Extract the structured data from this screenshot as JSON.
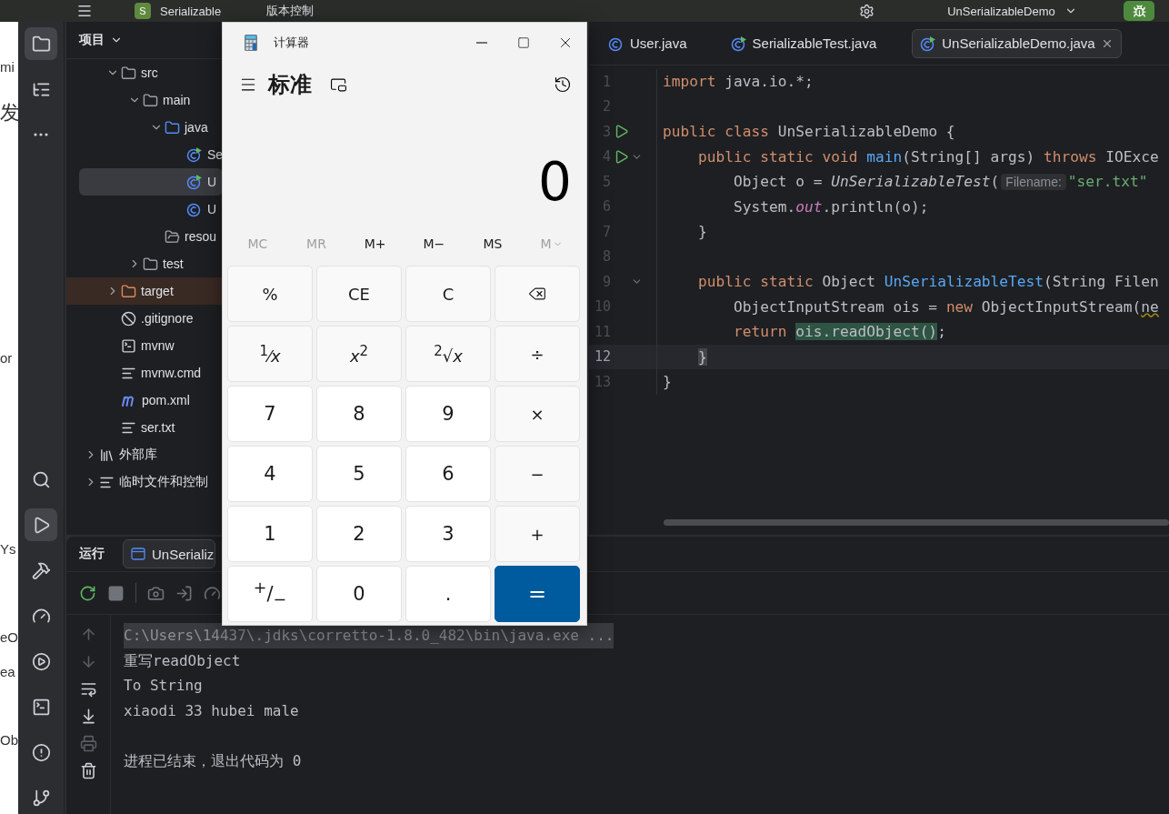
{
  "top_bar": {
    "project_badge": "S",
    "project": "Serializable",
    "vcs": "版本控制",
    "run_config": "UnSerializableDemo"
  },
  "browser_fragments": [
    {
      "text": "mi",
      "kind": "text"
    },
    {
      "text": "发",
      "kind": "heading"
    },
    {
      "text": "or",
      "kind": "text"
    },
    {
      "text": "Ys",
      "kind": "text"
    },
    {
      "text": "eO",
      "kind": "text"
    },
    {
      "text": "ea",
      "kind": "text"
    },
    {
      "text": "Ob",
      "kind": "text"
    }
  ],
  "rail": {
    "top": [
      {
        "kind": "folder",
        "selected": true
      },
      {
        "kind": "structure",
        "selected": false
      },
      {
        "kind": "more",
        "selected": false
      }
    ],
    "bottom": [
      {
        "kind": "search",
        "selected": false
      },
      {
        "kind": "run",
        "selected": true
      },
      {
        "kind": "build",
        "selected": false
      },
      {
        "kind": "profiler",
        "selected": false
      },
      {
        "kind": "services",
        "selected": false
      },
      {
        "kind": "terminal",
        "selected": false
      },
      {
        "kind": "problems",
        "selected": false
      },
      {
        "kind": "git",
        "selected": false
      }
    ]
  },
  "project_panel": {
    "title": "项目",
    "tree": [
      {
        "kind": "scrolled",
        "children": [
          {
            "label": "src",
            "kind": "folder",
            "expanded": true,
            "selected": false,
            "children": [
              {
                "label": "main",
                "kind": "folder",
                "expanded": true,
                "selected": false,
                "children": [
                  {
                    "label": "java",
                    "kind": "source-folder",
                    "expanded": true,
                    "selected": false,
                    "children": [
                      {
                        "label": "Se",
                        "kind": "class-run",
                        "selected": false
                      },
                      {
                        "label": "U",
                        "kind": "class-run",
                        "selected": true
                      },
                      {
                        "label": "U",
                        "kind": "class",
                        "selected": false
                      }
                    ]
                  },
                  {
                    "label": "resou",
                    "kind": "resources-folder",
                    "selected": false
                  }
                ]
              },
              {
                "label": "test",
                "kind": "folder",
                "expanded": false,
                "selected": false
              }
            ]
          },
          {
            "label": "target",
            "kind": "excluded-folder",
            "expanded": false,
            "selected": false
          },
          {
            "label": ".gitignore",
            "kind": "ignore",
            "selected": false
          },
          {
            "label": "mvnw",
            "kind": "script",
            "selected": false
          },
          {
            "label": "mvnw.cmd",
            "kind": "text",
            "selected": false
          },
          {
            "label": "pom.xml",
            "kind": "maven",
            "selected": false
          },
          {
            "label": "ser.txt",
            "kind": "text",
            "selected": false
          }
        ]
      },
      {
        "label": "外部库",
        "kind": "library",
        "expanded": false,
        "selected": false
      },
      {
        "label": "临时文件和控制",
        "kind": "scratch",
        "expanded": false,
        "selected": false
      }
    ]
  },
  "editor": {
    "tabs": [
      {
        "label": "User.java",
        "kind": "class",
        "selected": false
      },
      {
        "label": "SerializableTest.java",
        "kind": "class-run",
        "selected": false
      },
      {
        "label": "UnSerializableDemo.java",
        "kind": "class-run",
        "selected": true
      }
    ],
    "lines": [
      {
        "number": "1",
        "run": false,
        "fold": false,
        "current": false,
        "tokens": [
          {
            "text": "import ",
            "kind": "keyword"
          },
          {
            "text": "java.io.*;",
            "kind": "plain"
          }
        ]
      },
      {
        "number": "2",
        "run": false,
        "fold": false,
        "current": false
      },
      {
        "number": "3",
        "run": true,
        "fold": false,
        "current": false,
        "tokens": [
          {
            "text": "public class ",
            "kind": "keyword"
          },
          {
            "text": "UnSerializableDemo {",
            "kind": "plain"
          }
        ]
      },
      {
        "number": "4",
        "run": true,
        "fold": true,
        "current": false,
        "tokens": [
          {
            "text": "    public static void ",
            "kind": "keyword"
          },
          {
            "text": "main",
            "kind": "declaration"
          },
          {
            "text": "(String[] args) ",
            "kind": "plain"
          },
          {
            "text": "throws ",
            "kind": "keyword"
          },
          {
            "text": "IOExce",
            "kind": "plain"
          }
        ]
      },
      {
        "number": "5",
        "run": false,
        "fold": false,
        "current": false,
        "tokens": [
          {
            "text": "        Object o = ",
            "kind": "plain"
          },
          {
            "text": "UnSerializableTest",
            "kind": "static"
          },
          {
            "text": "(",
            "kind": "plain"
          },
          {
            "text": "Filename:",
            "kind": "hint"
          },
          {
            "text": "\"ser.txt\"",
            "kind": "string"
          }
        ]
      },
      {
        "number": "6",
        "run": false,
        "fold": false,
        "current": false,
        "tokens": [
          {
            "text": "        System.",
            "kind": "plain"
          },
          {
            "text": "out",
            "kind": "field"
          },
          {
            "text": ".println(o);",
            "kind": "plain"
          }
        ]
      },
      {
        "number": "7",
        "run": false,
        "fold": false,
        "current": false,
        "tokens": [
          {
            "text": "    }",
            "kind": "plain"
          }
        ]
      },
      {
        "number": "8",
        "run": false,
        "fold": false,
        "current": false
      },
      {
        "number": "9",
        "run": false,
        "fold": true,
        "current": false,
        "tokens": [
          {
            "text": "    public static ",
            "kind": "keyword"
          },
          {
            "text": "Object ",
            "kind": "plain"
          },
          {
            "text": "UnSerializableTest",
            "kind": "declaration"
          },
          {
            "text": "(String Filen",
            "kind": "plain"
          }
        ]
      },
      {
        "number": "10",
        "run": false,
        "fold": false,
        "current": false,
        "tokens": [
          {
            "text": "        ObjectInputStream ois = ",
            "kind": "plain"
          },
          {
            "text": "new ",
            "kind": "keyword"
          },
          {
            "text": "ObjectInputStream(",
            "kind": "plain"
          },
          {
            "text": "ne",
            "kind": "warning"
          }
        ]
      },
      {
        "number": "11",
        "run": false,
        "fold": false,
        "current": false,
        "tokens": [
          {
            "text": "        return ",
            "kind": "keyword"
          },
          {
            "text": "ois.readObject()",
            "kind": "match"
          },
          {
            "text": ";",
            "kind": "plain"
          }
        ]
      },
      {
        "number": "12",
        "run": false,
        "fold": false,
        "current": true,
        "tokens": [
          {
            "text": "    }",
            "kind": "brace"
          }
        ]
      },
      {
        "number": "13",
        "run": false,
        "fold": false,
        "current": false,
        "tokens": [
          {
            "text": "}",
            "kind": "plain"
          }
        ]
      }
    ]
  },
  "run_panel": {
    "title": "运行",
    "tab": "UnSerializ",
    "console": [
      {
        "text": "C:\\Users\\14437\\.jdks\\corretto-1.8.0_482\\bin\\java.exe ...",
        "kind": "command"
      },
      {
        "text": "重写readObject",
        "kind": "output"
      },
      {
        "text": "To String",
        "kind": "output"
      },
      {
        "text": "xiaodi 33 hubei male",
        "kind": "output"
      },
      {
        "kind": "blank"
      },
      {
        "text": "进程已结束，退出代码为 0",
        "kind": "output"
      }
    ]
  },
  "calculator": {
    "title": "计算器",
    "mode": "标准",
    "display": "0",
    "memory": [
      {
        "label": "MC",
        "disabled": true
      },
      {
        "label": "MR",
        "disabled": true
      },
      {
        "label": "M+",
        "disabled": false
      },
      {
        "label": "M−",
        "disabled": false
      },
      {
        "label": "MS",
        "disabled": false
      },
      {
        "label": "M",
        "disabled": true,
        "kind": "dropdown"
      }
    ],
    "keys": [
      {
        "label": "%",
        "kind": "function"
      },
      {
        "label": "CE",
        "kind": "function"
      },
      {
        "label": "C",
        "kind": "function"
      },
      {
        "kind": "backspace"
      },
      {
        "label": "$^{1}$⁄*x*",
        "kind": "function"
      },
      {
        "label": "*x*$^{2}$",
        "kind": "function"
      },
      {
        "label": "$^{2}$√*x*",
        "kind": "function"
      },
      {
        "label": "÷",
        "kind": "function"
      },
      {
        "label": "7",
        "kind": "digit"
      },
      {
        "label": "8",
        "kind": "digit"
      },
      {
        "label": "9",
        "kind": "digit"
      },
      {
        "label": "×",
        "kind": "function"
      },
      {
        "label": "4",
        "kind": "digit"
      },
      {
        "label": "5",
        "kind": "digit"
      },
      {
        "label": "6",
        "kind": "digit"
      },
      {
        "label": "−",
        "kind": "function"
      },
      {
        "label": "1",
        "kind": "digit"
      },
      {
        "label": "2",
        "kind": "digit"
      },
      {
        "label": "3",
        "kind": "digit"
      },
      {
        "label": "+",
        "kind": "function"
      },
      {
        "label": "$^{+}$/$_{−}$",
        "kind": "digit"
      },
      {
        "label": "0",
        "kind": "digit"
      },
      {
        "label": ".",
        "kind": "digit"
      },
      {
        "label": "=",
        "kind": "equals"
      }
    ]
  }
}
